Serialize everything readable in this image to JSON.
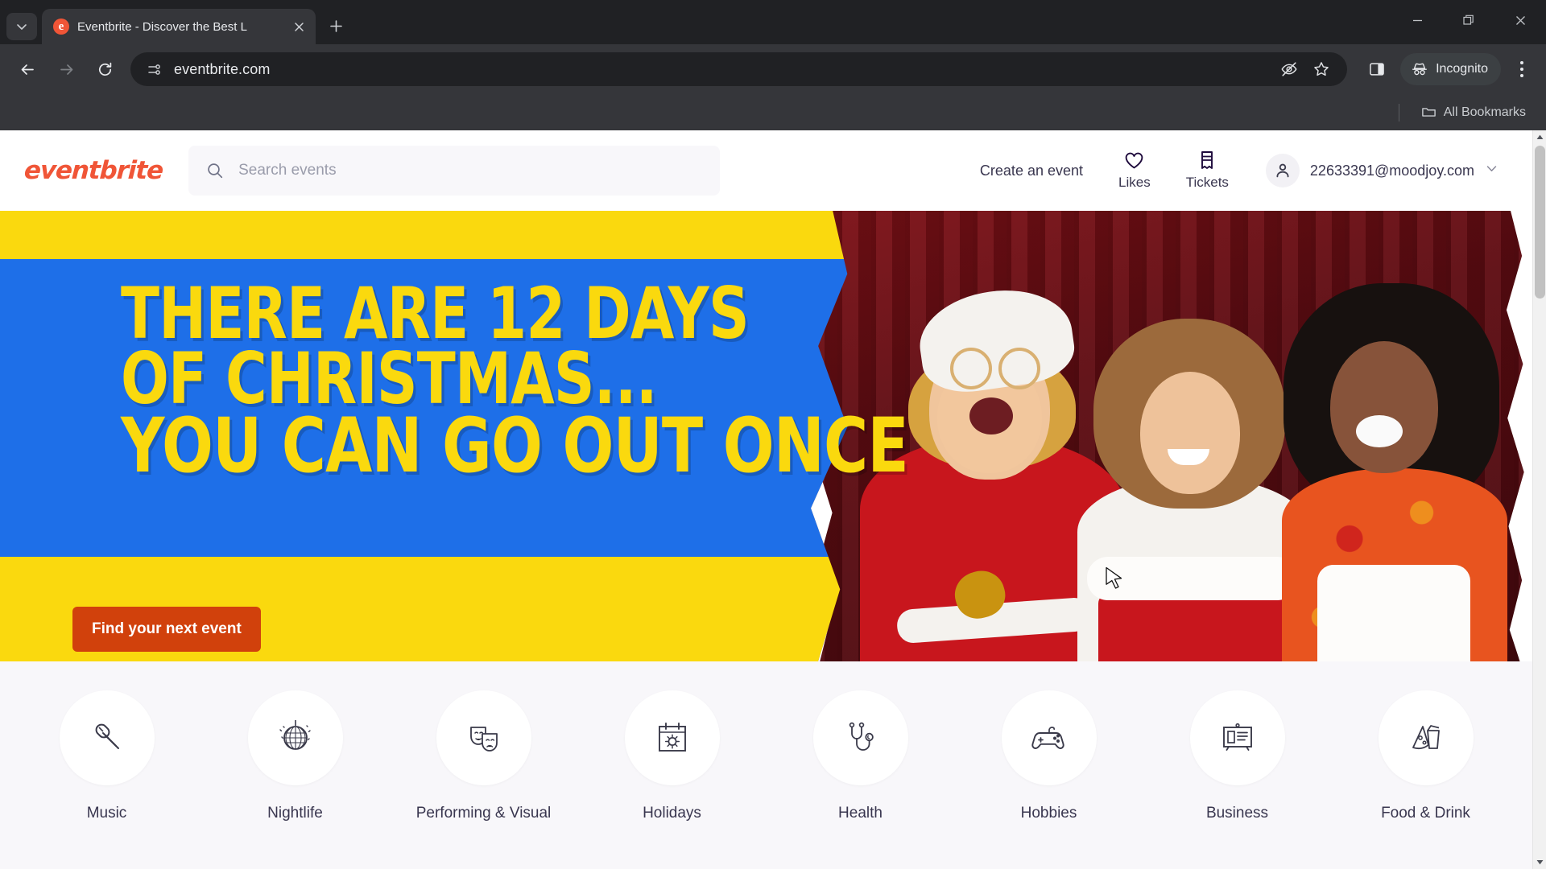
{
  "browser": {
    "tab": {
      "title": "Eventbrite - Discover the Best L",
      "favicon_letter": "e",
      "close_label": "Close tab",
      "new_tab_label": "New tab",
      "tab_search_label": "Search tabs"
    },
    "window_controls": {
      "minimize": "Minimize",
      "maximize": "Restore",
      "close": "Close"
    },
    "toolbar": {
      "back": "Back",
      "forward": "Forward",
      "reload": "Reload",
      "url": "eventbrite.com",
      "site_info": "site-settings-icon",
      "tracking_protection": "Tracking protection",
      "bookmark": "Bookmark this tab",
      "side_panel": "Side panel",
      "incognito_label": "Incognito",
      "menu": "Customize and control Google Chrome"
    },
    "bookmarks_bar": {
      "all_bookmarks_label": "All Bookmarks"
    }
  },
  "site": {
    "header": {
      "logo": "eventbrite",
      "search_placeholder": "Search events",
      "search_value": "",
      "create_event_label": "Create an event",
      "likes_label": "Likes",
      "tickets_label": "Tickets",
      "account_email": "22633391@moodjoy.com"
    },
    "hero": {
      "line1": "THERE ARE 12 DAYS",
      "line2": "OF CHRISTMAS...",
      "line3": "YOU CAN GO OUT ONCE",
      "cta_label": "Find your next event",
      "colors": {
        "yellow": "#FAD90E",
        "blue": "#1E6FE8",
        "cta": "#d1410c"
      }
    },
    "categories": [
      {
        "label": "Music",
        "icon": "microphone-icon"
      },
      {
        "label": "Nightlife",
        "icon": "disco-ball-icon"
      },
      {
        "label": "Performing & Visual",
        "icon": "theater-masks-icon"
      },
      {
        "label": "Holidays",
        "icon": "calendar-sun-icon"
      },
      {
        "label": "Health",
        "icon": "stethoscope-icon"
      },
      {
        "label": "Hobbies",
        "icon": "game-controller-icon"
      },
      {
        "label": "Business",
        "icon": "presentation-board-icon"
      },
      {
        "label": "Food & Drink",
        "icon": "pizza-drink-icon"
      }
    ]
  }
}
